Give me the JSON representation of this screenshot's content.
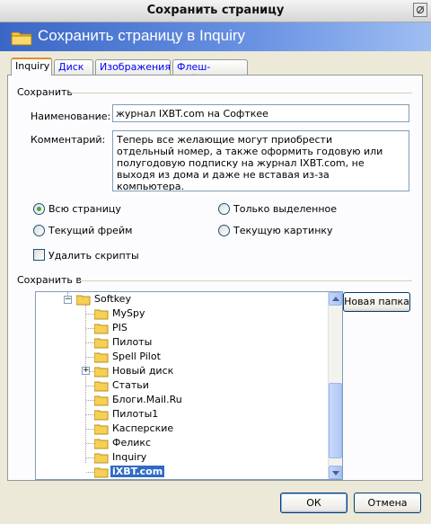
{
  "window": {
    "title": "Сохранить страницу"
  },
  "header": {
    "title": "Сохранить страницу в Inquiry"
  },
  "tabs": [
    {
      "label": "Inquiry"
    },
    {
      "label": "Диск"
    },
    {
      "label": "Изображения"
    },
    {
      "label": "Флеш-файлы"
    }
  ],
  "save": {
    "group_title": "Сохранить",
    "name_label": "Наименование:",
    "name_value": "журнал IXBT.com на Софткее",
    "comment_label": "Комментарий:",
    "comment_value": "Теперь все желающие могут приобрести отдельный номер, а также оформить годовую или полугодовую подписку на журнал IXBT.com, не выходя из дома и даже не вставая из-за компьютера.",
    "radios": {
      "whole_page": "Всю страницу",
      "selected_only": "Только выделенное",
      "current_frame": "Текущий фрейм",
      "current_picture": "Текущую картинку"
    },
    "remove_scripts": "Удалить скрипты"
  },
  "save_to": {
    "group_title": "Сохранить в",
    "new_folder": "Новая папка",
    "tree": [
      {
        "label": "Softkey"
      },
      {
        "label": "MySpy"
      },
      {
        "label": "PIS"
      },
      {
        "label": "Пилоты"
      },
      {
        "label": "Spell Pilot"
      },
      {
        "label": "Новый диск"
      },
      {
        "label": "Статьи"
      },
      {
        "label": "Блоги.Mail.Ru"
      },
      {
        "label": "Пилоты1"
      },
      {
        "label": "Касперские"
      },
      {
        "label": "Феликс"
      },
      {
        "label": "Inquiry"
      },
      {
        "label": "iXBT.com"
      }
    ]
  },
  "footer": {
    "ok": "ОК",
    "cancel": "Отмена"
  }
}
